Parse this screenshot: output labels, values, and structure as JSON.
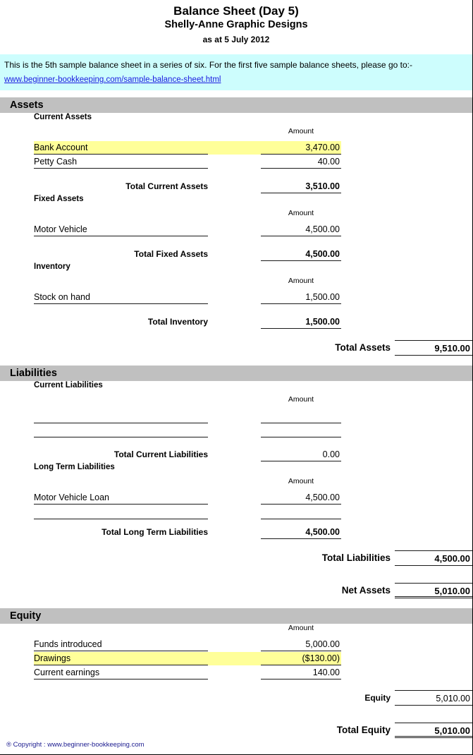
{
  "title": {
    "main": "Balance Sheet (Day 5)",
    "company": "Shelly-Anne Graphic Designs",
    "date": "as at 5 July 2012"
  },
  "notice": {
    "text": "This is the 5th sample balance sheet in a series of six. For the first five sample balance sheets, please go to:-",
    "link": "www.beginner-bookkeeping.com/sample-balance-sheet.html"
  },
  "amount_header": "Amount",
  "sections": {
    "assets": {
      "header": "Assets",
      "current": {
        "subhead": "Current Assets",
        "items": [
          {
            "desc": "Bank Account",
            "amount": "3,470.00",
            "highlight": true
          },
          {
            "desc": "Petty Cash",
            "amount": "40.00",
            "highlight": false
          }
        ],
        "total_label": "Total Current Assets",
        "total_amount": "3,510.00"
      },
      "fixed": {
        "subhead": "Fixed Assets",
        "items": [
          {
            "desc": "Motor Vehicle",
            "amount": "4,500.00",
            "highlight": false
          }
        ],
        "total_label": "Total Fixed Assets",
        "total_amount": "4,500.00"
      },
      "inventory": {
        "subhead": "Inventory",
        "items": [
          {
            "desc": "Stock on hand",
            "amount": "1,500.00",
            "highlight": false
          }
        ],
        "total_label": "Total Inventory",
        "total_amount": "1,500.00"
      },
      "grand_label": "Total Assets",
      "grand_amount": "9,510.00"
    },
    "liabilities": {
      "header": "Liabilities",
      "current": {
        "subhead": "Current Liabilities",
        "items": [],
        "blank_rows": 2,
        "total_label": "Total Current Liabilities",
        "total_amount": "0.00"
      },
      "longterm": {
        "subhead": "Long Term Liabilities",
        "items": [
          {
            "desc": "Motor Vehicle Loan",
            "amount": "4,500.00",
            "highlight": false
          }
        ],
        "blank_rows": 1,
        "total_label": "Total Long Term Liabilities",
        "total_amount": "4,500.00"
      },
      "grand_label": "Total Liabilities",
      "grand_amount": "4,500.00",
      "net_label": "Net Assets",
      "net_amount": "5,010.00"
    },
    "equity": {
      "header": "Equity",
      "items": [
        {
          "desc": "Funds introduced",
          "amount": "5,000.00",
          "highlight": false
        },
        {
          "desc": "Drawings",
          "amount": "($130.00)",
          "highlight": true
        },
        {
          "desc": "Current earnings",
          "amount": "140.00",
          "highlight": false
        }
      ],
      "subtotal_label": "Equity",
      "subtotal_amount": "5,010.00",
      "grand_label": "Total Equity",
      "grand_amount": "5,010.00"
    }
  },
  "footer": "® Copyright : www.beginner-bookkeeping.com",
  "colors": {
    "section_bar": "#c0c0c0",
    "notice_bg": "#cdfdfd",
    "highlight": "#ffff99",
    "link": "#1a1ae0",
    "footer_text": "#1b1b8f"
  }
}
